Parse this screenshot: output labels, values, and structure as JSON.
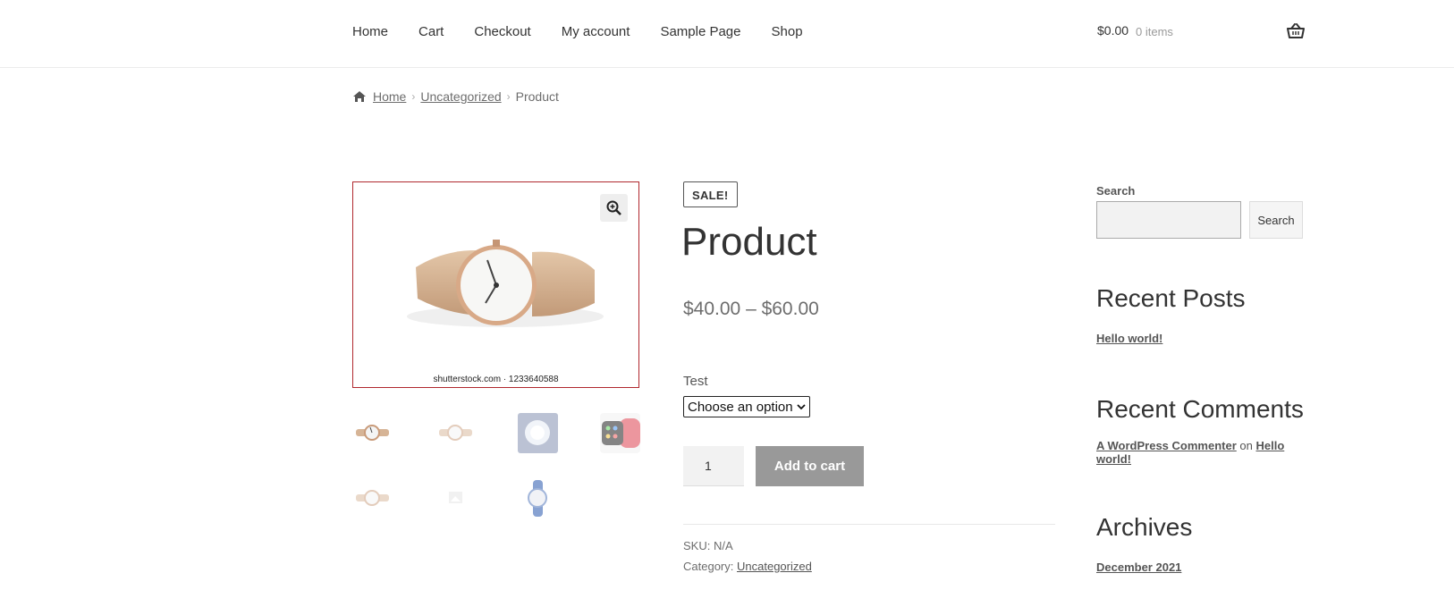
{
  "nav": {
    "items": [
      "Home",
      "Cart",
      "Checkout",
      "My account",
      "Sample Page",
      "Shop"
    ]
  },
  "header_cart": {
    "total": "$0.00",
    "count": "0 items"
  },
  "breadcrumb": {
    "home": "Home",
    "category": "Uncategorized",
    "current": "Product"
  },
  "gallery": {
    "watermark": "shutterstock.com · 1233640588"
  },
  "product": {
    "badge": "SALE!",
    "title": "Product",
    "price": "$40.00 – $60.00",
    "variation_label": "Test",
    "variation_value": "Choose an option",
    "quantity": "1",
    "add_to_cart": "Add to cart",
    "sku_label": "SKU:",
    "sku_value": "N/A",
    "category_label": "Category:",
    "category_value": "Uncategorized"
  },
  "sidebar": {
    "search_label": "Search",
    "search_button": "Search",
    "recent_posts_title": "Recent Posts",
    "recent_post": "Hello world!",
    "recent_comments_title": "Recent Comments",
    "comment_author": "A WordPress Commenter",
    "comment_on": "on",
    "comment_post": "Hello world!",
    "archives_title": "Archives",
    "archive_item": "December 2021"
  }
}
